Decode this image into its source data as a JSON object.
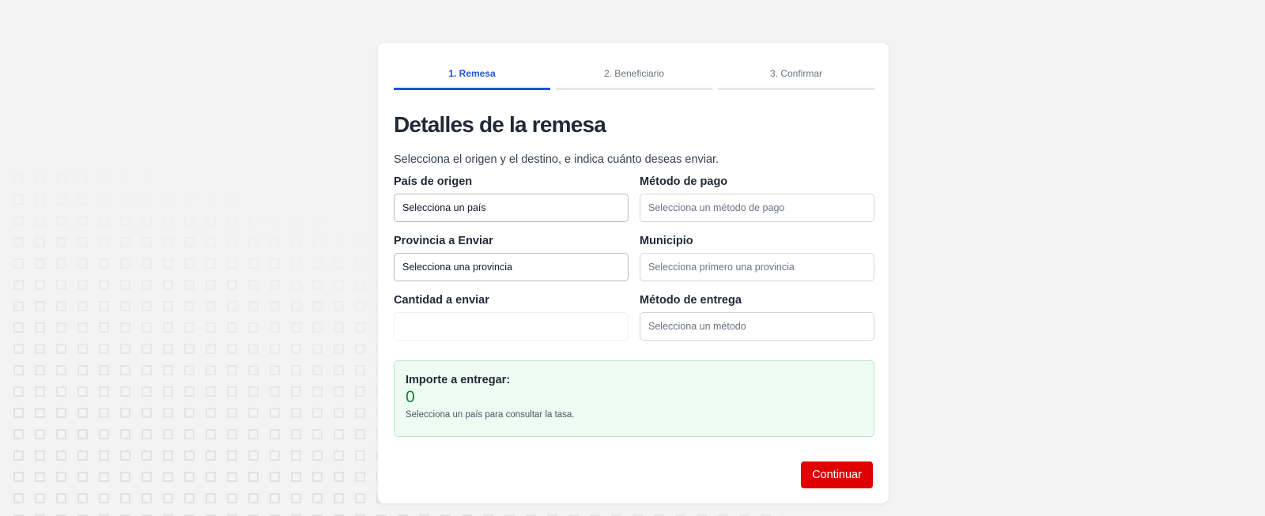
{
  "steps": [
    {
      "label": "1. Remesa"
    },
    {
      "label": "2. Beneficiario"
    },
    {
      "label": "3. Confirmar"
    }
  ],
  "form": {
    "title": "Detalles de la remesa",
    "subtitle": "Selecciona el origen y el destino, e indica cuánto deseas enviar.",
    "origin_country": {
      "label": "País de origen",
      "value": "Selecciona un país"
    },
    "payment_method": {
      "label": "Método de pago",
      "value": "Selecciona un método de pago"
    },
    "province": {
      "label": "Provincia a Enviar",
      "value": "Selecciona una provincia"
    },
    "municipality": {
      "label": "Municipio",
      "value": "Selecciona primero una provincia"
    },
    "amount": {
      "label": "Cantidad a enviar",
      "value": ""
    },
    "delivery_method": {
      "label": "Método de entrega",
      "value": "Selecciona un método"
    }
  },
  "result": {
    "label": "Importe a entregar:",
    "value": "0",
    "note": "Selecciona un país para consultar la tasa."
  },
  "actions": {
    "continue_label": "Continuar"
  },
  "colors": {
    "accent": "#2255d4",
    "primary_button": "#e00000",
    "result_bg": "#eefbf2",
    "result_value": "#16803c"
  }
}
